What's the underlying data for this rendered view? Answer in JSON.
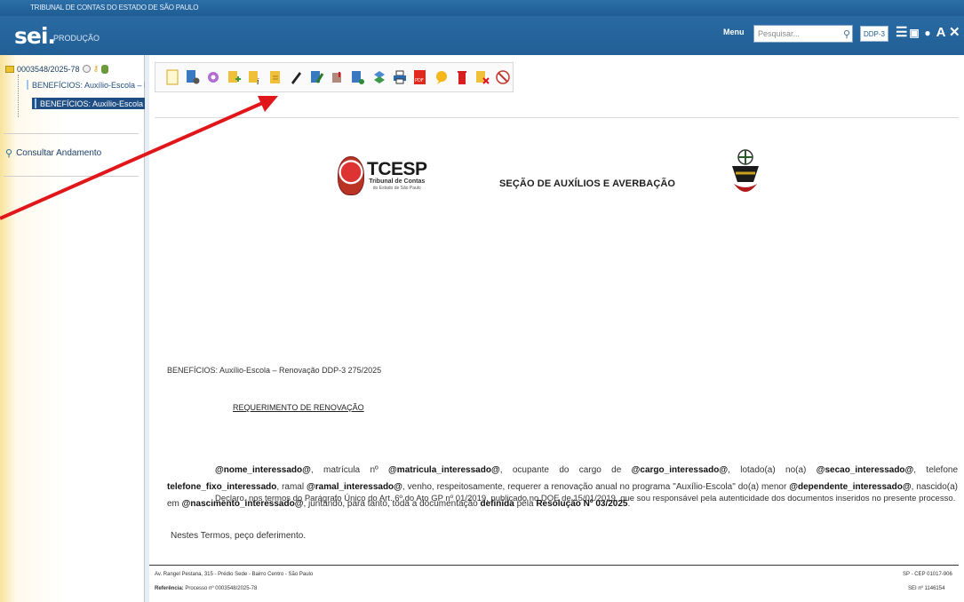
{
  "header": {
    "org_name": "TRIBUNAL DE CONTAS DO ESTADO DE SÃO PAULO",
    "logo": "sei.",
    "environment": "PRODUÇÃO",
    "menu_label": "Menu",
    "search_placeholder": "Pesquisar...",
    "unit": "DDP-3",
    "icons": [
      "search-icon",
      "list-icon",
      "panel-icon",
      "info-icon",
      "font-size-icon",
      "close-icon",
      "user-icon",
      "exit-icon"
    ]
  },
  "tree": {
    "process_number": "0003548/2025-78",
    "documents": [
      {
        "label": "BENEFÍCIOS: Auxílio-Escola – Restauração",
        "selected": false
      },
      {
        "label": "BENEFÍCIOS: Auxílio-Escola – Renovação",
        "selected": true
      }
    ],
    "consult_label": "Consultar Andamento"
  },
  "toolbar": {
    "icons": [
      "new-document-icon",
      "document-settings-icon",
      "circle-icon",
      "add-file-icon",
      "info-file-icon",
      "edit-file-icon",
      "pen-icon",
      "sign-icon",
      "block-icon",
      "user-file-icon",
      "layers-icon",
      "print-icon",
      "pdf-icon",
      "comment-icon",
      "delete-icon",
      "remove-file-icon",
      "cancel-icon"
    ]
  },
  "document": {
    "org_short": "TCESP",
    "org_sub": "Tribunal de Contas",
    "org_sub2": "do Estado de São Paulo",
    "section_title": "SEÇÃO DE AUXÍLIOS E AVERBAÇÃO",
    "subject": "BENEFÍCIOS: Auxílio-Escola – Renovação DDP-3 275/2025",
    "request_title": "REQUERIMENTO DE RENOVAÇÃO",
    "paragraph": {
      "p1_name": "@nome_interessado@",
      "p1_t1": ", matrícula nº ",
      "p1_mat": "@matricula_interessado@",
      "p1_t2": ", ocupante do cargo de ",
      "p1_cargo": "@cargo_interessado@",
      "p1_t3": ", lotado(a) no(a) ",
      "p1_secao": "@secao_interessado@",
      "p1_t4": ", telefone ",
      "p1_tel": "telefone_fixo_interessado",
      "p1_t5": ", ramal ",
      "p1_ramal": "@ramal_interessado@",
      "p1_t6": ", venho, respeitosamente, requerer a renovação anual no programa \"Auxílio-Escola\" do(a) menor ",
      "p1_dep": "@dependente_interessado@",
      "p1_t7": ", nascido(a) em ",
      "p1_nasc": "@nascimento_interessado@",
      "p1_t8": ", juntando, para tanto, toda a documentação ",
      "p1_def": "definida",
      "p1_t9": " pela ",
      "p1_res": "Resolução Nº 03/2025",
      "p1_t10": "."
    },
    "declaration": "Declaro, nos termos do Parágrafo Único do Art. 6º do Ato GP nº 01/2019, publicado no DOE de 15/01/2019, que sou responsável pela autenticidade dos documentos inseridos no presente processo.",
    "closing": "Nestes Termos, peço deferimento.",
    "footer": {
      "address": "Av. Rangel Pestana, 315 - Prédio Sede - Bairro Centro - São Paulo",
      "reference_label": "Referência:",
      "reference_value": "Processo nº 0003548/2025-78",
      "cep": "SP - CEP 01017-906",
      "sei_number": "SEI nº 1146154"
    }
  },
  "colors": {
    "header_blue": "#215f96",
    "selection": "#1f4e85",
    "arrow": "#e0161b"
  }
}
